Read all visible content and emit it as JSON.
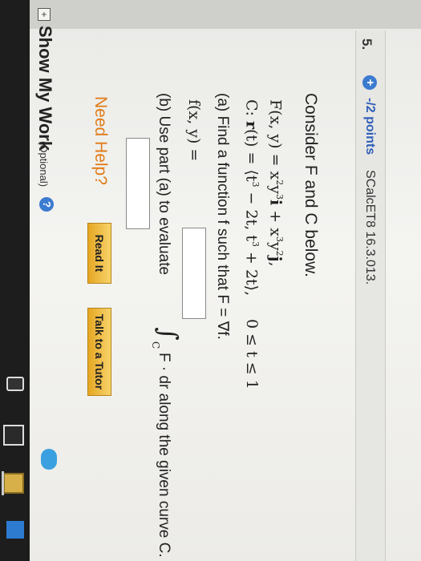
{
  "question": {
    "number": "5.",
    "points": "-/2 points",
    "code": "SCalcET8 16.3.013."
  },
  "problem": {
    "intro": "Consider F and C below.",
    "field_F": "F(x, y) = x²y³i + x³y²j,",
    "curve_C": "C: r(t) = ⟨t³ − 2t, t³ + 2t⟩,",
    "range": "0 ≤ t ≤ 1",
    "part_a": "(a) Find a function f such that F = ∇f.",
    "answer_a_label": "f(x, y) =",
    "part_b_pre": "(b) Use part (a) to evaluate",
    "integral_symbol": "∫",
    "integral_sub": "C",
    "part_b_post": "F · dr along the given curve C."
  },
  "help": {
    "need_help": "Need Help?",
    "read_it": "Read It",
    "talk_tutor": "Talk to a Tutor"
  },
  "show_work": {
    "label": "Show My Work",
    "optional": "(Optional)",
    "help_glyph": "?"
  },
  "icons": {
    "expand": "plus-icon",
    "help": "question-circle-icon"
  },
  "colors": {
    "link_blue": "#3060b8",
    "need_help_orange": "#e07b18",
    "button_gold": "#e6a623"
  }
}
